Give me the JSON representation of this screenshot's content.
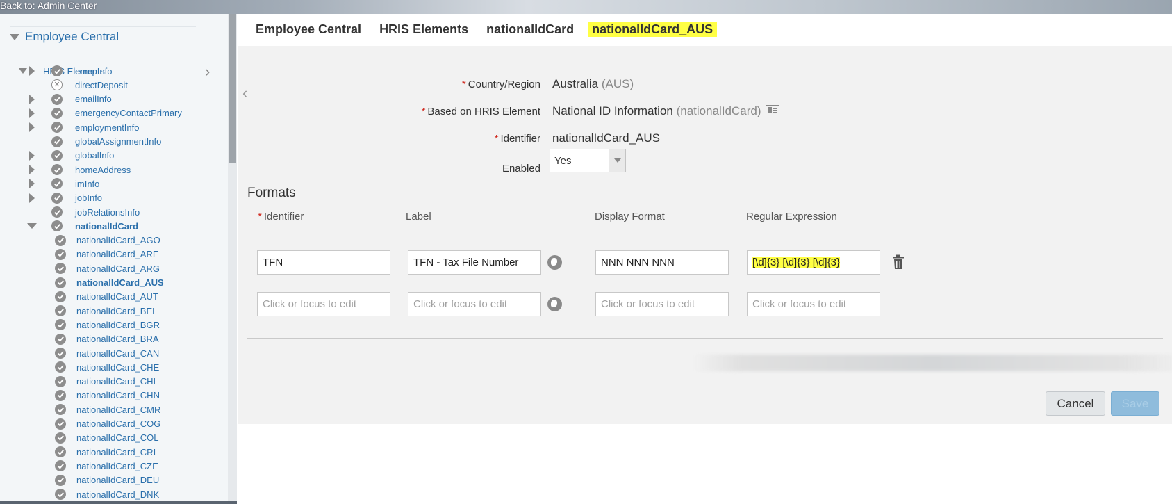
{
  "topbar": {
    "back_link": "Back to: Admin Center"
  },
  "tree": {
    "root_label": "Employee Central",
    "group_label": "HRIS Elements",
    "items": [
      {
        "label": "compInfo",
        "expander": true,
        "status": "ok"
      },
      {
        "label": "directDeposit",
        "expander": false,
        "status": "disabled"
      },
      {
        "label": "emailInfo",
        "expander": true,
        "status": "ok"
      },
      {
        "label": "emergencyContactPrimary",
        "expander": true,
        "status": "ok"
      },
      {
        "label": "employmentInfo",
        "expander": true,
        "status": "ok"
      },
      {
        "label": "globalAssignmentInfo",
        "expander": false,
        "status": "ok"
      },
      {
        "label": "globalInfo",
        "expander": true,
        "status": "ok"
      },
      {
        "label": "homeAddress",
        "expander": true,
        "status": "ok"
      },
      {
        "label": "imInfo",
        "expander": true,
        "status": "ok"
      },
      {
        "label": "jobInfo",
        "expander": true,
        "status": "ok"
      },
      {
        "label": "jobRelationsInfo",
        "expander": false,
        "status": "ok"
      },
      {
        "label": "nationalIdCard",
        "expander": "open",
        "status": "ok",
        "bold": true
      }
    ],
    "children": [
      {
        "label": "nationalIdCard_AGO"
      },
      {
        "label": "nationalIdCard_ARE"
      },
      {
        "label": "nationalIdCard_ARG"
      },
      {
        "label": "nationalIdCard_AUS",
        "selected": true
      },
      {
        "label": "nationalIdCard_AUT"
      },
      {
        "label": "nationalIdCard_BEL"
      },
      {
        "label": "nationalIdCard_BGR"
      },
      {
        "label": "nationalIdCard_BRA"
      },
      {
        "label": "nationalIdCard_CAN"
      },
      {
        "label": "nationalIdCard_CHE"
      },
      {
        "label": "nationalIdCard_CHL"
      },
      {
        "label": "nationalIdCard_CHN"
      },
      {
        "label": "nationalIdCard_CMR"
      },
      {
        "label": "nationalIdCard_COG"
      },
      {
        "label": "nationalIdCard_COL"
      },
      {
        "label": "nationalIdCard_CRI"
      },
      {
        "label": "nationalIdCard_CZE"
      },
      {
        "label": "nationalIdCard_DEU"
      },
      {
        "label": "nationalIdCard_DNK"
      }
    ]
  },
  "breadcrumb": [
    "Employee Central",
    "HRIS Elements",
    "nationalIdCard",
    "nationalIdCard_AUS"
  ],
  "form": {
    "required_mark": "*",
    "country": {
      "label": "Country/Region",
      "value": "Australia",
      "code": "(AUS)"
    },
    "based_on": {
      "label": "Based on HRIS Element",
      "value": "National ID Information",
      "code": "(nationalIdCard)"
    },
    "identifier": {
      "label": "Identifier",
      "value": "nationalIdCard_AUS"
    },
    "enabled": {
      "label": "Enabled",
      "value": "Yes"
    }
  },
  "formats": {
    "title": "Formats",
    "columns": {
      "identifier": "Identifier",
      "label": "Label",
      "display_format": "Display Format",
      "regex": "Regular Expression"
    },
    "rows": [
      {
        "identifier": "TFN",
        "label": "TFN - Tax File Number",
        "display_format": "NNN NNN NNN",
        "regex": "[\\d]{3} [\\d]{3} [\\d]{3}"
      }
    ],
    "placeholder": "Click or focus to edit"
  },
  "actions": {
    "cancel": "Cancel",
    "save": "Save"
  },
  "colors": {
    "link": "#2a6fab",
    "highlight": "#ffff44",
    "required": "#d0271d",
    "save_bg": "#8fbcdc"
  },
  "icons": [
    "chevron-left-icon",
    "check-circle-icon",
    "x-circle-icon",
    "globe-icon",
    "trash-icon",
    "id-card-icon",
    "caret-down-icon"
  ]
}
